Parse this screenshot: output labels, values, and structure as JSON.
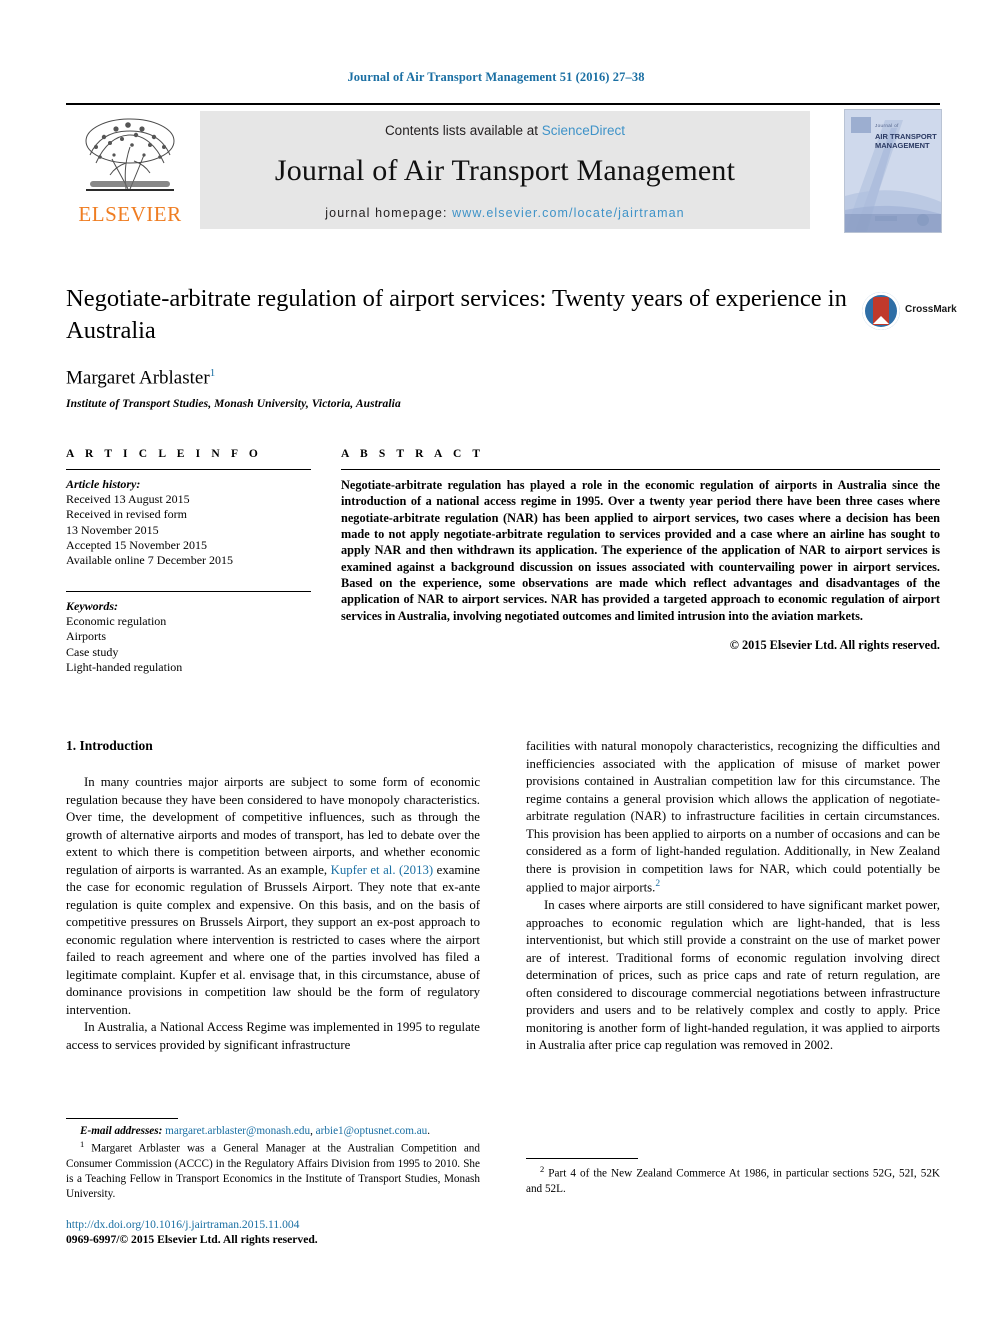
{
  "running_head": "Journal of Air Transport Management 51 (2016) 27–38",
  "masthead": {
    "contents_prefix": "Contents lists available at ",
    "sciencedirect": "ScienceDirect",
    "journal_title": "Journal of Air Transport Management",
    "homepage_prefix": "journal homepage: ",
    "homepage_url": "www.elsevier.com/locate/jairtraman",
    "publisher": "ELSEVIER",
    "cover": {
      "kicker": "Journal of",
      "title": "AIR TRANSPORT MANAGEMENT"
    }
  },
  "article": {
    "title": "Negotiate-arbitrate regulation of airport services: Twenty years of experience in Australia",
    "author": "Margaret Arblaster",
    "author_footnote_marker": "1",
    "affiliation": "Institute of Transport Studies, Monash University, Victoria, Australia",
    "crossmark_label": "CrossMark"
  },
  "article_info": {
    "heading": "A R T I C L E   I N F O",
    "history_label": "Article history:",
    "history": [
      "Received 13 August 2015",
      "Received in revised form",
      "13 November 2015",
      "Accepted 15 November 2015",
      "Available online 7 December 2015"
    ],
    "keywords_label": "Keywords:",
    "keywords": [
      "Economic regulation",
      "Airports",
      "Case study",
      "Light-handed regulation"
    ]
  },
  "abstract": {
    "heading": "A B S T R A C T",
    "text": "Negotiate-arbitrate regulation has played a role in the economic regulation of airports in Australia since the introduction of a national access regime in 1995. Over a twenty year period there have been three cases where negotiate-arbitrate regulation (NAR) has been applied to airport services, two cases where a decision has been made to not apply negotiate-arbitrate regulation to services provided and a case where an airline has sought to apply NAR and then withdrawn its application. The experience of the application of NAR to airport services is examined against a background discussion on issues associated with countervailing power in airport services. Based on the experience, some observations are made which reflect advantages and disadvantages of the application of NAR to airport services. NAR has provided a targeted approach to economic regulation of airport services in Australia, involving negotiated outcomes and limited intrusion into the aviation markets.",
    "copyright": "© 2015 Elsevier Ltd. All rights reserved."
  },
  "body": {
    "section_heading": "1. Introduction",
    "left_para_1_a": "In many countries major airports are subject to some form of economic regulation because they have been considered to have monopoly characteristics. Over time, the development of competitive influences, such as through the growth of alternative airports and modes of transport, has led to debate over the extent to which there is competition between airports, and whether economic regulation of airports is warranted. As an example, ",
    "left_para_1_ref": "Kupfer et al. (2013)",
    "left_para_1_b": " examine the case for economic regulation of Brussels Airport. They note that ex-ante regulation is quite complex and expensive. On this basis, and on the basis of competitive pressures on Brussels Airport, they support an ex-post approach to economic regulation where intervention is restricted to cases where the airport failed to reach agreement and where one of the parties involved has filed a legitimate complaint. Kupfer et al. envisage that, in this circumstance, abuse of dominance provisions in competition law should be the form of regulatory intervention.",
    "left_para_2": "In Australia, a National Access Regime was implemented in 1995 to regulate access to services provided by significant infrastructure",
    "right_para_1_a": "facilities with natural monopoly characteristics, recognizing the difficulties and inefficiencies associated with the application of misuse of market power provisions contained in Australian competition law for this circumstance. The regime contains a general provision which allows the application of negotiate-arbitrate regulation (NAR) to infrastructure facilities in certain circumstances. This provision has been applied to airports on a number of occasions and can be considered as a form of light-handed regulation. Additionally, in New Zealand there is provision in competition laws for NAR, which could potentially be applied to major airports.",
    "right_para_1_fn": "2",
    "right_para_2": "In cases where airports are still considered to have significant market power, approaches to economic regulation which are light-handed, that is less interventionist, but which still provide a constraint on the use of market power are of interest. Traditional forms of economic regulation involving direct determination of prices, such as price caps and rate of return regulation, are often considered to discourage commercial negotiations between infrastructure providers and users and to be relatively complex and costly to apply. Price monitoring is another form of light-handed regulation, it was applied to airports in Australia after price cap regulation was removed in 2002."
  },
  "footnotes": {
    "email_label": "E-mail addresses:",
    "email_1": "margaret.arblaster@monash.edu",
    "email_sep": ", ",
    "email_2": "arbie1@optusnet.com.au",
    "email_end": ".",
    "note_1_marker": "1",
    "note_1": "Margaret Arblaster was a General Manager at the Australian Competition and Consumer Commission (ACCC) in the Regulatory Affairs Division from 1995 to 2010. She is a Teaching Fellow in Transport Economics in the Institute of Transport Studies, Monash University.",
    "note_2_marker": "2",
    "note_2": "Part 4 of the New Zealand Commerce At 1986, in particular sections 52G, 52I, 52K and 52L."
  },
  "footer": {
    "doi": "http://dx.doi.org/10.1016/j.jairtraman.2015.11.004",
    "issn": "0969-6997/© 2015 Elsevier Ltd. All rights reserved."
  },
  "colors": {
    "link": "#1a6fa3",
    "sciencedirect": "#3f93c8",
    "elsevier_orange": "#ef7d22",
    "band_grey": "#e6e6e6"
  }
}
